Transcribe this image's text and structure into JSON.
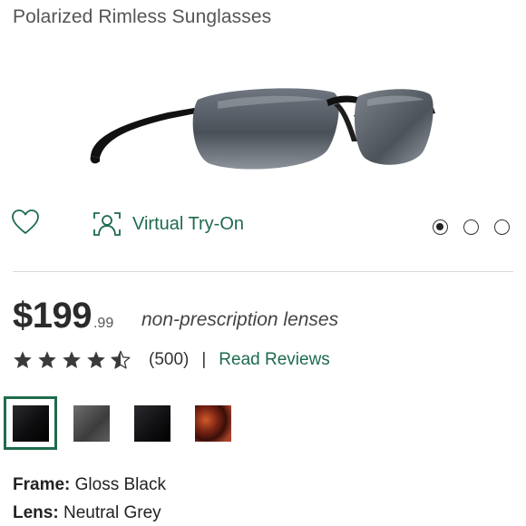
{
  "product": {
    "title": "Polarized Rimless Sunglasses",
    "image_alt": "sunglasses-product-image"
  },
  "actions": {
    "wishlist_icon": "heart-outline-icon",
    "virtual_try_on_icon": "face-scan-icon",
    "virtual_try_on_label": "Virtual Try-On"
  },
  "carousel": {
    "total": 3,
    "active_index": 0
  },
  "price": {
    "dollars": "$199",
    "cents": ".99",
    "lens_type": "non-prescription lenses"
  },
  "rating": {
    "stars": 4.5,
    "max": 5,
    "count_text": "(500)",
    "separator": "|",
    "reviews_link": "Read Reviews"
  },
  "swatches": [
    {
      "name": "Gloss Black",
      "color": "#0d0d0f",
      "selected": true
    },
    {
      "name": "Grey",
      "color": "#5a5a5a",
      "selected": false
    },
    {
      "name": "Black",
      "color": "#111114",
      "selected": false
    },
    {
      "name": "Tortoise",
      "color": "#8a2e1a",
      "selected": false
    }
  ],
  "specs": {
    "frame_label": "Frame:",
    "frame_value": "Gloss Black",
    "lens_label": "Lens:",
    "lens_value": "Neutral Grey"
  },
  "colors": {
    "accent_green": "#1c6b4c",
    "text": "#2b2b2b",
    "star": "#3a3a3a"
  }
}
